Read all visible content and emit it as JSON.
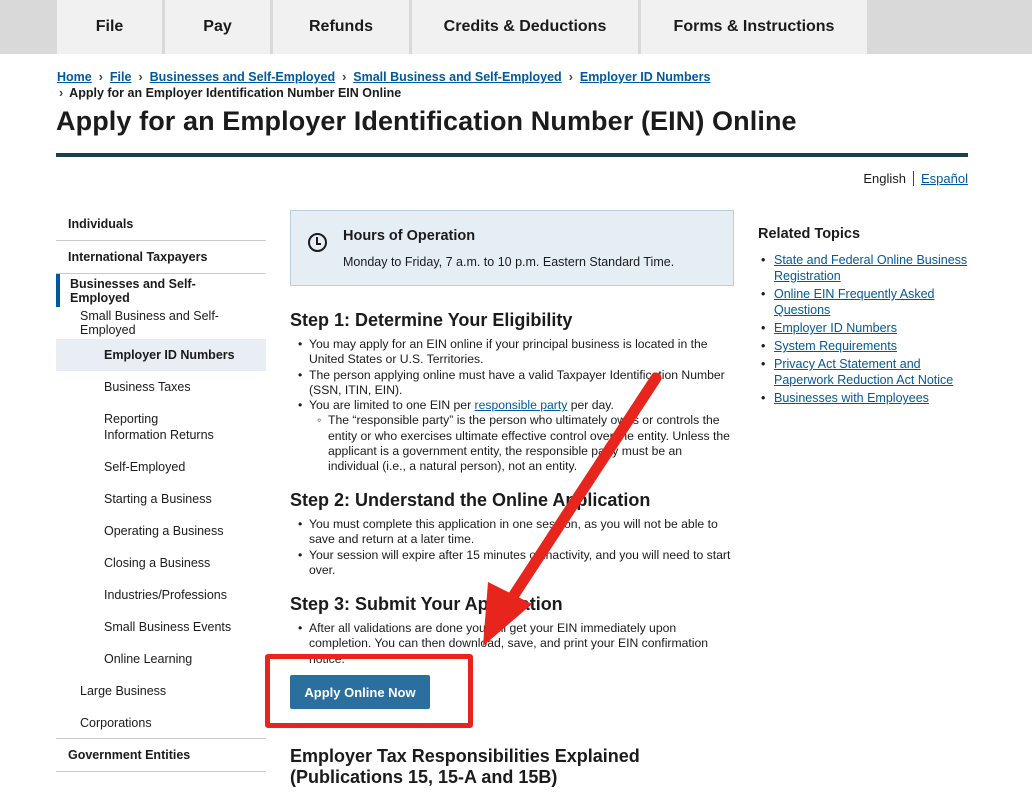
{
  "topnav": {
    "tabs": [
      "File",
      "Pay",
      "Refunds",
      "Credits & Deductions",
      "Forms & Instructions"
    ]
  },
  "breadcrumb": {
    "links": [
      "Home",
      "File",
      "Businesses and Self-Employed",
      "Small Business and Self-Employed",
      "Employer ID Numbers"
    ],
    "current": "Apply for an Employer Identification Number EIN Online"
  },
  "page": {
    "title": "Apply for an Employer Identification Number (EIN) Online"
  },
  "language": {
    "english": "English",
    "espanol": "Español"
  },
  "sidebar": {
    "items": [
      "Individuals",
      "International Taxpayers",
      "Businesses and Self-Employed",
      "Small Business and Self-Employed",
      "Employer ID Numbers",
      "Business Taxes",
      "Reporting Information Returns",
      "Self-Employed",
      "Starting a Business",
      "Operating a Business",
      "Closing a Business",
      "Industries/Professions",
      "Small Business Events",
      "Online Learning",
      "Large Business",
      "Corporations",
      "Government Entities"
    ]
  },
  "hours": {
    "title": "Hours of Operation",
    "text": "Monday to Friday, 7 a.m. to 10 p.m. Eastern Standard Time."
  },
  "step1": {
    "heading": "Step 1: Determine Your Eligibility",
    "b1": "You may apply for an EIN online if your principal business is located in the United States or U.S. Territories.",
    "b2": "The person applying online must have a valid Taxpayer Identification Number (SSN, ITIN, EIN).",
    "b3_pre": "You are limited to one EIN per ",
    "b3_link": "responsible party",
    "b3_post": " per day.",
    "sub": "The “responsible party” is the person who ultimately owns or controls the entity or who exercises ultimate effective control over the entity. Unless the applicant is a government entity, the responsible party must be an individual (i.e., a natural person), not an entity."
  },
  "step2": {
    "heading": "Step 2: Understand the Online Application",
    "b1": "You must complete this application in one session, as you will not be able to save and return at a later time.",
    "b2": "Your session will expire after 15 minutes of inactivity, and you will need to start over."
  },
  "step3": {
    "heading": "Step 3: Submit Your Application",
    "b1": "After all validations are done you will get your EIN immediately upon completion. You can then download, save, and print your EIN confirmation notice."
  },
  "apply_button": "Apply Online Now",
  "employer_heading": "Employer Tax Responsibilities Explained (Publications 15, 15-A and 15B)",
  "related": {
    "title": "Related Topics",
    "links": [
      "State and Federal Online Business Registration",
      "Online EIN Frequently Asked Questions",
      "Employer ID Numbers",
      "System Requirements",
      "Privacy Act Statement and Paperwork Reduction Act Notice",
      "Businesses with Employees"
    ]
  },
  "colors": {
    "link": "#00599c",
    "button": "#2a6f9e",
    "annotation_red": "#e8251c",
    "title_rule": "#1f3e4c",
    "hours_bg": "#e6eef5"
  }
}
